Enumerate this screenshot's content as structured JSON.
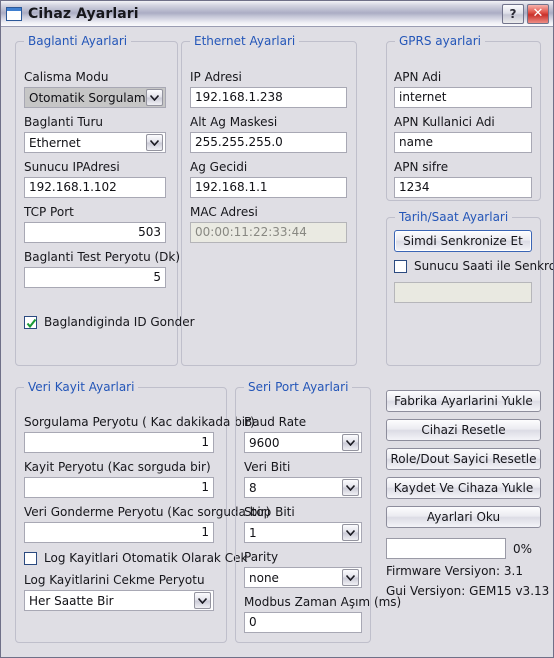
{
  "window": {
    "title": "Cihaz Ayarlari",
    "icon": "window-icon",
    "help_button": "?",
    "close_button": "✕"
  },
  "connection_group": {
    "legend": "Baglanti Ayarlari",
    "calisma_modu_label": "Calisma Modu",
    "calisma_modu_value": "Otomatik Sorgulama",
    "baglanti_turu_label": "Baglanti Turu",
    "baglanti_turu_value": "Ethernet",
    "sunucu_ip_label": "Sunucu IPAdresi",
    "sunucu_ip_value": "192.168.1.102",
    "tcp_port_label": "TCP Port",
    "tcp_port_value": "503",
    "test_peryotu_label": "Baglanti Test Peryotu (Dk)",
    "test_peryotu_value": "5",
    "id_gonder_label": "Baglandiginda ID Gonder",
    "id_gonder_checked": "checked"
  },
  "ethernet_group": {
    "legend": "Ethernet Ayarlari",
    "ip_label": "IP Adresi",
    "ip_value": "192.168.1.238",
    "mask_label": "Alt Ag Maskesi",
    "mask_value": "255.255.255.0",
    "gateway_label": "Ag Gecidi",
    "gateway_value": "192.168.1.1",
    "mac_label": "MAC Adresi",
    "mac_value": "00:00:11:22:33:44"
  },
  "gprs_group": {
    "legend": "GPRS ayarlari",
    "apn_adi_label": "APN Adi",
    "apn_adi_value": "internet",
    "apn_user_label": "APN Kullanici Adi",
    "apn_user_value": "name",
    "apn_pass_label": "APN sifre",
    "apn_pass_value": "1234"
  },
  "datetime_group": {
    "legend": "Tarih/Saat Ayarlari",
    "sync_now_button": "Simdi Senkronize Et",
    "server_sync_label": "Sunucu Saati ile Senkron",
    "server_sync_checked": "unchecked",
    "datetime_value": ""
  },
  "datalog_group": {
    "legend": "Veri Kayit Ayarlari",
    "sorgulama_label": "Sorgulama Peryotu ( Kac dakikada bir)",
    "sorgulama_value": "1",
    "kayit_label": "Kayit Peryotu (Kac sorguda bir)",
    "kayit_value": "1",
    "gonderme_label": "Veri Gonderme Peryotu (Kac sorguda bir)",
    "gonderme_value": "1",
    "auto_log_label": "Log Kayitlari Otomatik Olarak  Cek",
    "auto_log_checked": "unchecked",
    "cekme_peryotu_label": "Log Kayitlarini Cekme Peryotu",
    "cekme_peryotu_value": "Her Saatte Bir"
  },
  "serial_group": {
    "legend": "Seri Port Ayarlari",
    "baud_label": "Baud Rate",
    "baud_value": "9600",
    "databits_label": "Veri Biti",
    "databits_value": "8",
    "stopbits_label": "Stop Biti",
    "stopbits_value": "1",
    "parity_label": "Parity",
    "parity_value": "none",
    "timeout_label": "Modbus Zaman Aşım (ms)",
    "timeout_value": "0"
  },
  "actions": {
    "factory_reset": "Fabrika Ayarlarini Yukle",
    "device_reset": "Cihazi Resetle",
    "counter_reset": "Role/Dout Sayici Resetle",
    "save_upload": "Kaydet Ve Cihaza Yukle",
    "read_settings": "Ayarlari Oku",
    "progress_percent": "0%",
    "progress_value": 0,
    "firmware_version": "Firmware Versiyon: 3.1",
    "gui_version": "Gui Versiyon: GEM15 v3.13"
  },
  "colors": {
    "dialog_bg": "#dfdee4",
    "legend_blue": "#2456b8",
    "close_red": "#c8302a",
    "check_green": "#1a9a36"
  }
}
